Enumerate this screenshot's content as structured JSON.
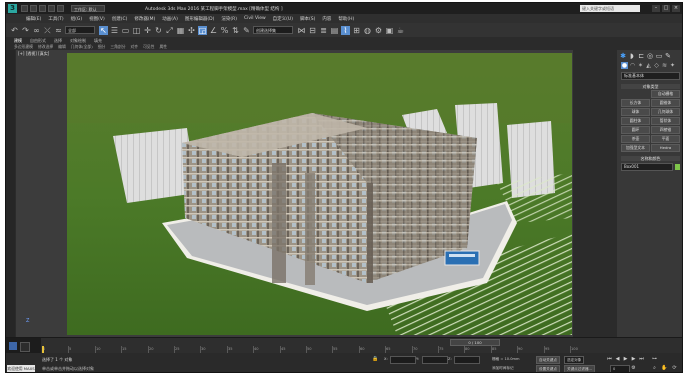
{
  "titlebar": {
    "logo": "3",
    "workspace": "工作区: 默认",
    "title": "Autodesk 3ds Max 2016   某工程脚手架模型.max  [精确体型 结构 ]",
    "search_placeholder": "键入关键字或短语",
    "minimize": "–",
    "maximize": "□",
    "close": "×"
  },
  "menubar": {
    "items": [
      "编辑(E)",
      "工具(T)",
      "组(G)",
      "视图(V)",
      "创建(C)",
      "修改器(M)",
      "动画(A)",
      "图形编辑器(D)",
      "渲染(R)",
      "Civil View",
      "自定义(U)",
      "脚本(S)",
      "内容",
      "帮助(H)"
    ]
  },
  "toolbar": {
    "selection_filter": "全部",
    "selection_set": "创建选择集",
    "icons": [
      "undo-icon",
      "redo-icon",
      "link-icon",
      "unlink-icon",
      "bind-icon",
      "select-icon",
      "select-name-icon",
      "region-icon",
      "window-crossing-icon",
      "move-icon",
      "rotate-icon",
      "scale-icon",
      "reference-icon",
      "pivot-icon",
      "snap-icon",
      "angle-snap-icon",
      "percent-snap-icon",
      "spinner-snap-icon",
      "edit-named-icon",
      "mirror-icon",
      "align-icon",
      "layer-icon",
      "graphite-icon",
      "curve-editor-icon",
      "schematic-icon",
      "material-editor-icon",
      "render-setup-icon",
      "render-frame-icon",
      "render-icon"
    ]
  },
  "ribbon": {
    "tabs": [
      "建模",
      "自由形式",
      "选择",
      "对象绘制",
      "填充"
    ],
    "active": "建模",
    "subtabs": [
      "多边形建模",
      "修改选择",
      "编辑",
      "几何体(全部)",
      "细分",
      "三角剖分",
      "对齐",
      "可见性",
      "属性"
    ]
  },
  "viewport": {
    "label": "[+] [透视] [真实]",
    "axis_label": "Z"
  },
  "command_panel": {
    "tabs": [
      "create-icon",
      "modify-icon",
      "hierarchy-icon",
      "motion-icon",
      "display-icon",
      "utilities-icon"
    ],
    "subtabs": [
      "geometry-icon",
      "shapes-icon",
      "lights-icon",
      "cameras-icon",
      "helpers-icon",
      "spacewarps-icon",
      "systems-icon"
    ],
    "category": "标准基本体",
    "object_type_header": "对象类型",
    "autogrid": "自动栅格",
    "buttons": [
      "长方体",
      "圆锥体",
      "球体",
      "几何球体",
      "圆柱体",
      "管状体",
      "圆环",
      "四棱锥",
      "茶壶",
      "平面",
      "加强型文本",
      "Hedra"
    ],
    "name_color_header": "名称和颜色",
    "name_value": "Box001",
    "name_color": "#7fc54a"
  },
  "timeline": {
    "frame_display": "0 / 100",
    "ticks": [
      "0",
      "5",
      "10",
      "15",
      "20",
      "25",
      "30",
      "35",
      "40",
      "45",
      "50",
      "55",
      "60",
      "65",
      "70",
      "75",
      "80",
      "85",
      "90",
      "95",
      "100"
    ],
    "current_frame": 0
  },
  "statusbar": {
    "maxscript": "欢迎使用 MAXS",
    "status_line1": "选择了 1 个 对象",
    "status_line2": "单击或单击并拖动以选择对象",
    "x_label": "X:",
    "x_value": "",
    "y_label": "Y:",
    "y_value": "",
    "z_label": "Z:",
    "z_value": "",
    "grid": "栅格 = 10.0mm",
    "auto_key": "自动关键点",
    "set_key": "设置关键点",
    "key_filter": "关键点过滤器...",
    "selected_dd": "选定对象",
    "add_time_tag": "添加时间标记",
    "frame_field": "0",
    "playback": [
      "|◀",
      "◀|",
      "▶",
      "|▶",
      "▶|"
    ]
  }
}
